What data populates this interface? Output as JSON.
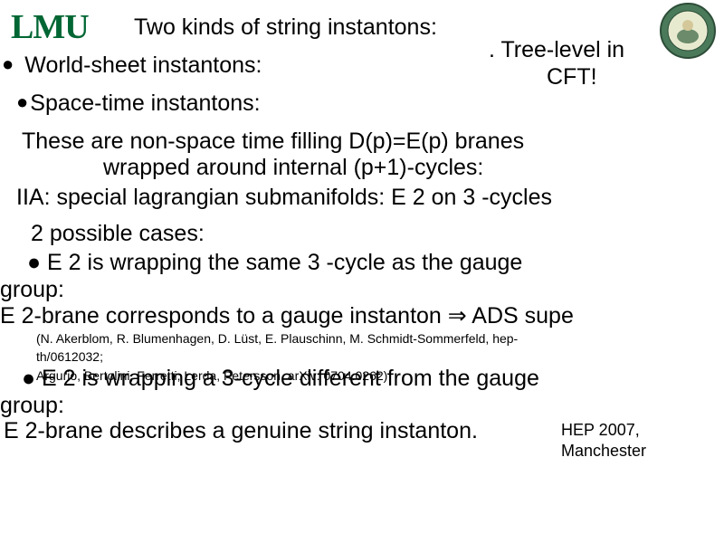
{
  "logos": {
    "lmu": "LMU"
  },
  "title": "Two kinds of string instantons:",
  "tree_level_line1": ".  Tree-level in",
  "tree_level_line2": "CFT!",
  "bullets": {
    "world_sheet": "World-sheet instantons:",
    "space_time": "Space-time instantons:"
  },
  "body": {
    "p1_line1": "These are non-space time filling D(p)=E(p) branes",
    "p1_line2": "wrapped around internal (p+1)-cycles:",
    "p2": "IIA: special lagrangian submanifolds: E 2 on 3 -cycles",
    "cases": "2 possible cases:",
    "case1": "●  E 2 is wrapping the same 3 -cycle as the gauge",
    "group1": "group:",
    "e2line": "E 2-brane corresponds to a gauge instanton ⇒ ADS supe",
    "refs_line1": "(N. Akerblom, R. Blumenhagen, D. Lüst, E. Plauschinn, M. Schmidt-Sommerfeld, hep-",
    "refs_line2": "th/0612032;",
    "refs_line3": "Argurio, Bertolini, Ferretti, Lerda, Petersson, arXiv: 0704.0262)",
    "case2": "●   E 2 is wrapping a 3-cycle different from the gauge",
    "group2": "group:",
    "genuine": "E 2-brane describes a genuine string instanton."
  },
  "footer": {
    "line1": "HEP 2007,",
    "line2": "Manchester"
  }
}
